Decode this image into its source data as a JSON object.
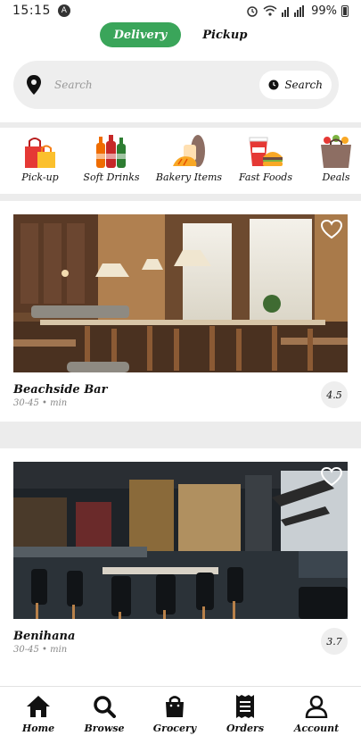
{
  "status_bar": {
    "time": "15:15",
    "app_icon": "A",
    "battery": "99%"
  },
  "mode_toggle": {
    "delivery": "Delivery",
    "pickup": "Pickup"
  },
  "search": {
    "placeholder": "Search",
    "button_label": "Search"
  },
  "categories": [
    {
      "label": "Pick-up",
      "icon": "shopping-bags-icon"
    },
    {
      "label": "Soft Drinks",
      "icon": "soda-bottles-icon"
    },
    {
      "label": "Bakery Items",
      "icon": "bread-icon"
    },
    {
      "label": "Fast Foods",
      "icon": "burger-drink-icon"
    },
    {
      "label": "Deals",
      "icon": "grocery-bag-icon"
    }
  ],
  "restaurants": [
    {
      "name": "Beachside Bar",
      "eta": "30-45 • min",
      "rating": "4.5"
    },
    {
      "name": "Benihana",
      "eta": "30-45 • min",
      "rating": "3.7"
    }
  ],
  "bottom_nav": [
    {
      "label": "Home",
      "icon": "home-icon"
    },
    {
      "label": "Browse",
      "icon": "search-icon"
    },
    {
      "label": "Grocery",
      "icon": "shopping-bag-icon"
    },
    {
      "label": "Orders",
      "icon": "receipt-icon"
    },
    {
      "label": "Account",
      "icon": "user-icon"
    }
  ],
  "colors": {
    "accent": "#3aa55a",
    "surface": "#eeeeee"
  }
}
